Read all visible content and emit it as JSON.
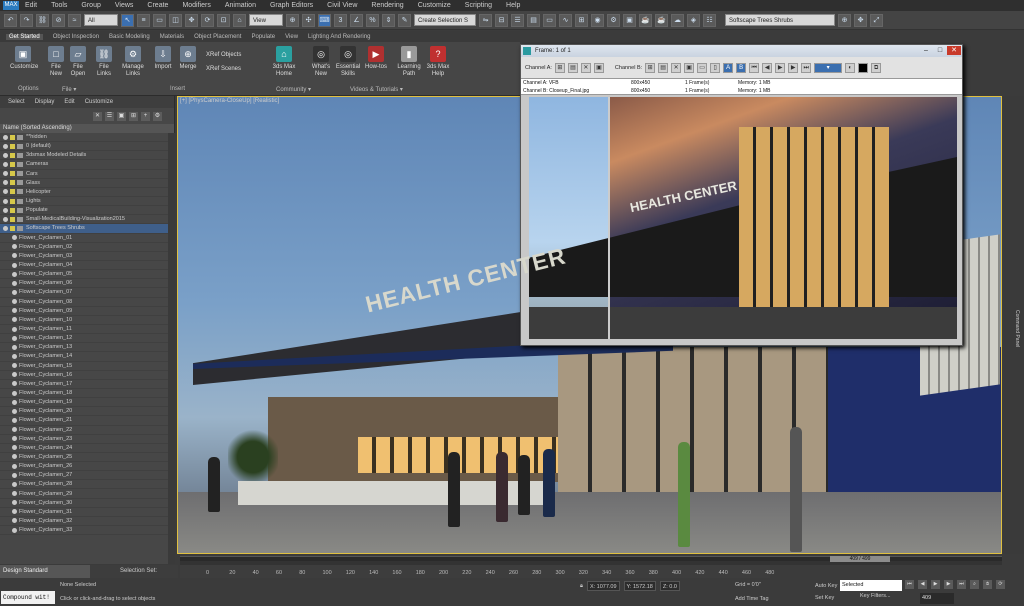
{
  "app": {
    "logo": "MAX"
  },
  "menu": [
    "Edit",
    "Tools",
    "Group",
    "Views",
    "Create",
    "Modifiers",
    "Animation",
    "Graph Editors",
    "Civil View",
    "Rendering",
    "Customize",
    "Scripting",
    "Help"
  ],
  "toolbar": {
    "filter": "All",
    "coord": "View",
    "selection_set": "Create Selection S",
    "layer_dropdown": "Softscape Trees Shrubs"
  },
  "ribbon": {
    "tabs": [
      "Get Started",
      "Object Inspection",
      "Basic Modeling",
      "Materials",
      "Object Placement",
      "Populate",
      "View",
      "Lighting And Rendering"
    ],
    "active_tab": "Get Started",
    "buttons": [
      {
        "label": "Customize"
      },
      {
        "label": "File New"
      },
      {
        "label": "File Open"
      },
      {
        "label": "File Links"
      },
      {
        "label": "Manage Links"
      },
      {
        "label": "Import"
      },
      {
        "label": "Merge"
      },
      {
        "label": "XRef Objects"
      },
      {
        "label": "XRef Scenes"
      },
      {
        "label": "3ds Max Home"
      },
      {
        "label": "What's New"
      },
      {
        "label": "Essential Skills"
      },
      {
        "label": "How-tos"
      },
      {
        "label": "Learning Path"
      },
      {
        "label": "3ds Max Help"
      }
    ],
    "groups": [
      "Options",
      "File ▾",
      "Insert",
      "Community ▾",
      "Videos & Tutorials ▾"
    ]
  },
  "scene_explorer": {
    "menu": [
      "Select",
      "Display",
      "Edit",
      "Customize"
    ],
    "column_header": "Name (Sorted Ascending)",
    "layers": [
      "**hidden",
      "0 (default)",
      "3dsmax Modeled Details",
      "Cameras",
      "Cars",
      "Glass",
      "Helicopter",
      "Lights",
      "Populate",
      "Small-MedicalBuilding-Visualization2015",
      "Softscape Trees Shrubs"
    ],
    "objects": [
      "Flower_Cyclamen_01",
      "Flower_Cyclamen_02",
      "Flower_Cyclamen_03",
      "Flower_Cyclamen_04",
      "Flower_Cyclamen_05",
      "Flower_Cyclamen_06",
      "Flower_Cyclamen_07",
      "Flower_Cyclamen_08",
      "Flower_Cyclamen_09",
      "Flower_Cyclamen_10",
      "Flower_Cyclamen_11",
      "Flower_Cyclamen_12",
      "Flower_Cyclamen_13",
      "Flower_Cyclamen_14",
      "Flower_Cyclamen_15",
      "Flower_Cyclamen_16",
      "Flower_Cyclamen_17",
      "Flower_Cyclamen_18",
      "Flower_Cyclamen_19",
      "Flower_Cyclamen_20",
      "Flower_Cyclamen_21",
      "Flower_Cyclamen_22",
      "Flower_Cyclamen_23",
      "Flower_Cyclamen_24",
      "Flower_Cyclamen_25",
      "Flower_Cyclamen_26",
      "Flower_Cyclamen_27",
      "Flower_Cyclamen_28",
      "Flower_Cyclamen_29",
      "Flower_Cyclamen_30",
      "Flower_Cyclamen_31",
      "Flower_Cyclamen_32",
      "Flower_Cyclamen_33"
    ]
  },
  "viewport": {
    "label": "[+] [PhysCamera-CloseUp] [Realistic]",
    "sign": "HEALTH CENTER",
    "side_label": "Command Panel"
  },
  "frame_buffer": {
    "title": "Frame: 1 of 1",
    "channel_a_label": "Channel A:",
    "channel_b_label": "Channel B:",
    "channel_a": {
      "name": "Channel A: VFB",
      "size": "800x450",
      "frames": "1 Frame(s)",
      "memory": "Memory: 1 MB"
    },
    "channel_b": {
      "name": "Channel B: Closeup_Final.jpg",
      "size": "800x450",
      "frames": "1 Frame(s)",
      "memory": "Memory: 1 MB"
    },
    "sign": "HEALTH CENTER",
    "controls": {
      "minimize": "–",
      "maximize": "□",
      "close": "✕"
    }
  },
  "timeline": {
    "position": "409 / 499",
    "ticks": [
      "0",
      "20",
      "40",
      "60",
      "80",
      "100",
      "120",
      "140",
      "160",
      "180",
      "200",
      "220",
      "240",
      "260",
      "280",
      "300",
      "320",
      "340",
      "360",
      "380",
      "400",
      "420",
      "440",
      "460",
      "480"
    ]
  },
  "status": {
    "design_standard": "Design Standard",
    "selection_set": "Selection Set:",
    "maxscript": "Compound wit!",
    "none_selected": "None Selected",
    "prompt": "Click or click-and-drag to select objects",
    "x": "X: 1077.09",
    "y": "Y: 1572.18",
    "z": "Z: 0.0",
    "grid": "Grid = 0'0\"",
    "add_time_tag": "Add Time Tag",
    "auto_key": "Auto Key",
    "set_key": "Set Key",
    "key_selected": "Selected",
    "key_filters": "Key Filters...",
    "frame": "409"
  }
}
